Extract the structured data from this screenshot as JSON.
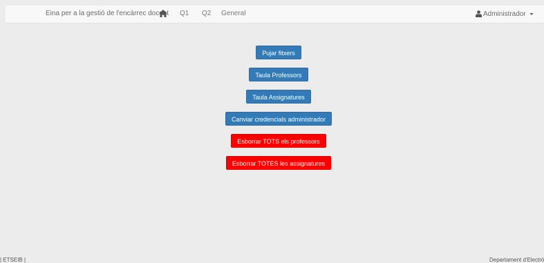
{
  "navbar": {
    "brand": "Eina per a la gestió de l'encàrrec docent",
    "home_icon": "home-icon",
    "links": [
      "Q1",
      "Q2",
      "General"
    ],
    "user_label": "Administrador",
    "user_icon": "user-icon",
    "caret_icon": "caret-down-icon"
  },
  "actions": {
    "upload_files": "Pujar fitxers",
    "teachers_table": "Taula Professors",
    "subjects_table": "Taula Assignatures",
    "change_credentials": "Canviar credencials administrador",
    "delete_all_teachers": "Esborrar TOTS els professors",
    "delete_all_subjects": "Esborrar TOTES les assignatures"
  },
  "colors": {
    "primary": "#337ab7",
    "danger": "#fa0000",
    "background": "#ececec",
    "navbar": "#f8f8f8"
  },
  "footer": {
    "left": "| ETSEIB |",
    "right": "Departament d'Electròni"
  }
}
